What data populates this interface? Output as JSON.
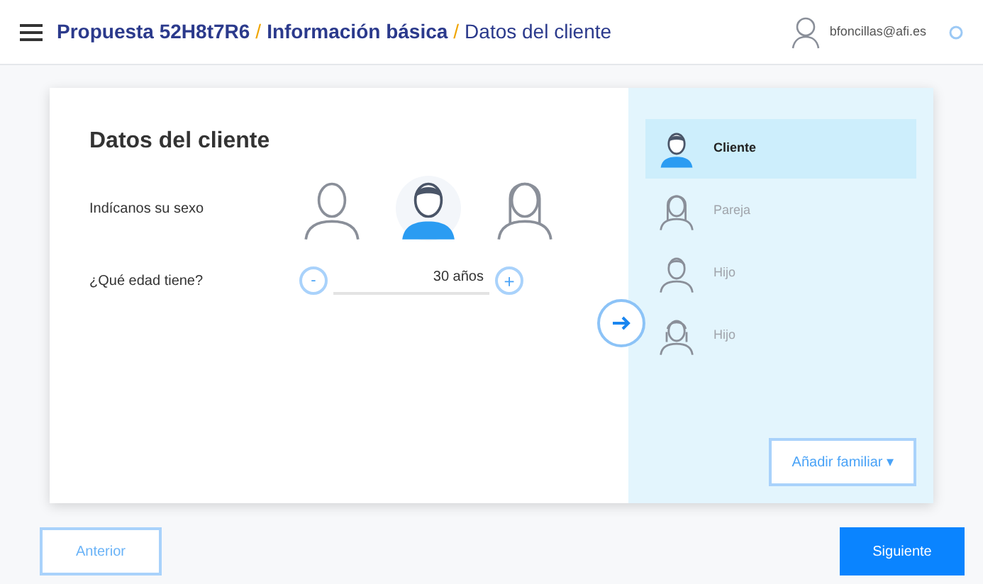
{
  "header": {
    "breadcrumb": [
      {
        "label": "Propuesta 52H8t7R6",
        "current": false,
        "separator": "/"
      },
      {
        "label": "Información básica",
        "current": false,
        "separator": "/"
      },
      {
        "label": "Datos del cliente",
        "current": true
      }
    ],
    "user": "bfoncillas@afi.es"
  },
  "form": {
    "title": "Datos del cliente",
    "sex_label": "Indícanos su sexo",
    "sex_options": [
      {
        "kind": "neutral",
        "selected": false
      },
      {
        "kind": "male",
        "selected": true
      },
      {
        "kind": "female",
        "selected": false
      }
    ],
    "age_label": "¿Qué edad tiene?",
    "age": {
      "minus": "-",
      "value": "30 años",
      "plus": "+"
    }
  },
  "family": {
    "members": [
      {
        "label": "Cliente",
        "kind": "male",
        "selected": true
      },
      {
        "label": "Pareja",
        "kind": "female",
        "selected": false
      },
      {
        "label": "Hijo",
        "kind": "child",
        "selected": false
      },
      {
        "label": "Hijo",
        "kind": "girl",
        "selected": false
      }
    ],
    "add_button": "Añadir familiar ▾"
  },
  "buttons": {
    "previous": "Anterior",
    "next": "Siguiente"
  }
}
